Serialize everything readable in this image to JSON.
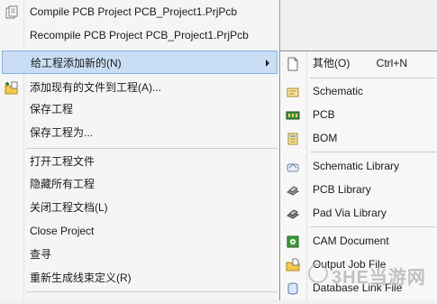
{
  "main_menu": {
    "items": [
      {
        "label": "Compile PCB Project PCB_Project1.PrjPcb",
        "icon": "compile-icon"
      },
      {
        "label": "Recompile PCB Project PCB_Project1.PrjPcb",
        "icon": ""
      },
      {
        "label": "给工程添加新的(N)",
        "icon": "",
        "highlighted": true,
        "has_submenu": true
      },
      {
        "label": "添加现有的文件到工程(A)...",
        "icon": "add-existing-file-icon"
      },
      {
        "label": "保存工程",
        "icon": ""
      },
      {
        "label": "保存工程为...",
        "icon": ""
      },
      {
        "label": "打开工程文件",
        "icon": ""
      },
      {
        "label": "隐藏所有工程",
        "icon": ""
      },
      {
        "label": "关闭工程文档(L)",
        "icon": ""
      },
      {
        "label": "Close Project",
        "icon": ""
      },
      {
        "label": "查寻",
        "icon": ""
      },
      {
        "label": "重新生成线束定义(R)",
        "icon": ""
      }
    ]
  },
  "sub_menu": {
    "items": [
      {
        "label": "其他(O)",
        "shortcut": "Ctrl+N",
        "icon": "blank-document-icon"
      },
      {
        "label": "Schematic",
        "icon": "schematic-icon"
      },
      {
        "label": "PCB",
        "icon": "pcb-icon"
      },
      {
        "label": "BOM",
        "icon": "bom-icon"
      },
      {
        "label": "Schematic Library",
        "icon": "schematic-library-icon"
      },
      {
        "label": "PCB Library",
        "icon": "pcb-library-icon"
      },
      {
        "label": "Pad Via Library",
        "icon": "pad-via-library-icon"
      },
      {
        "label": "CAM Document",
        "icon": "cam-document-icon"
      },
      {
        "label": "Output Job File",
        "icon": "output-job-file-icon"
      },
      {
        "label": "Database Link File",
        "icon": "database-link-file-icon"
      }
    ]
  },
  "watermark": {
    "text": "3HE当游网"
  },
  "colors": {
    "highlight_bg": "#c9def5",
    "highlight_border": "#86b4e8",
    "menu_bg": "#f5f5f5"
  }
}
